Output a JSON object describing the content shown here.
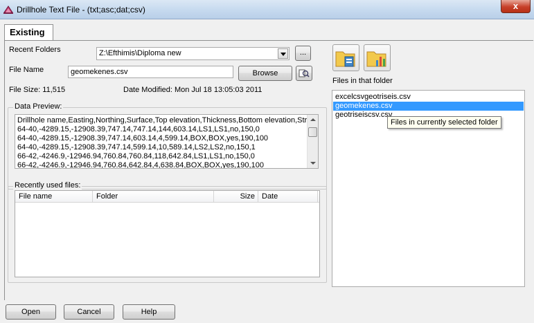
{
  "window": {
    "title": "Drillhole Text File - (txt;asc;dat;csv)",
    "close_label": "x"
  },
  "tab": {
    "label": "Existing"
  },
  "recent_folders": {
    "label": "Recent Folders",
    "value": "Z:\\Efthimis\\Diploma new",
    "browse_dots_label": "..."
  },
  "file_name": {
    "label": "File Name",
    "value": "geomekenes.csv",
    "browse_label": "Browse"
  },
  "file_info": {
    "size_text": "File Size: 11,515",
    "date_text": "Date Modified: Mon Jul 18 13:05:03 2011"
  },
  "data_preview": {
    "legend": "Data Preview:",
    "lines": [
      "Drillhole name,Easting,Northing,Surface,Top elevation,Thickness,Bottom elevation,Strata",
      "64-40,-4289.15,-12908.39,747.14,747.14,144,603.14,LS1,LS1,no,150,0",
      "64-40,-4289.15,-12908.39,747.14,603.14,4,599.14,BOX,BOX,yes,190,100",
      "64-40,-4289.15,-12908.39,747.14,599.14,10,589.14,LS2,LS2,no,150,1",
      "66-42,-4246.9,-12946.94,760.84,760.84,118,642.84,LS1,LS1,no,150,0",
      "66-42,-4246.9,-12946.94,760.84,642.84,4,638.84,BOX,BOX,yes,190,100"
    ]
  },
  "recent_files": {
    "legend": "Recently used files:",
    "columns": [
      "File name",
      "Folder",
      "Size",
      "Date"
    ]
  },
  "folder_files": {
    "label": "Files in that folder",
    "items": [
      "excelcsvgeotriseis.csv",
      "geomekenes.csv",
      "geotriseiscsv.csv"
    ],
    "selected_index": 1,
    "tooltip": "Files in currently selected folder"
  },
  "buttons": {
    "open": "Open",
    "cancel": "Cancel",
    "help": "Help"
  },
  "colors": {
    "selection": "#3399ff",
    "window_bg": "#f0f0f0"
  },
  "icons": {
    "app": "drillhole-app-icon",
    "close": "close-icon",
    "open_folder_file": "folder-file-icon",
    "folder_chart": "folder-chart-icon",
    "file_search": "file-search-icon"
  }
}
